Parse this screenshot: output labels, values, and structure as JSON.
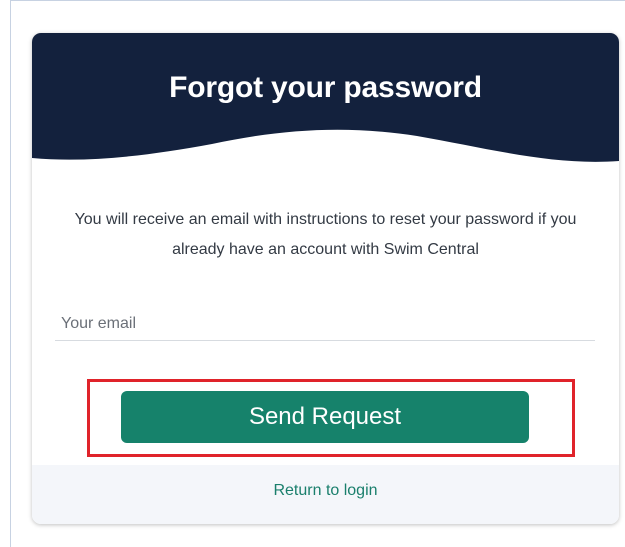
{
  "title": "Forgot your password",
  "info_text": "You will receive an email with instructions to reset your password if you already have an account with Swim Central",
  "email": {
    "value": "",
    "placeholder": "Your email"
  },
  "send_button_label": "Send Request",
  "return_link_label": "Return to login",
  "colors": {
    "header_navy": "#13213d",
    "button_green": "#16826b",
    "link_green": "#1a7f6c",
    "highlight_red": "#e0232a",
    "footer_bg": "#f4f6fa"
  }
}
